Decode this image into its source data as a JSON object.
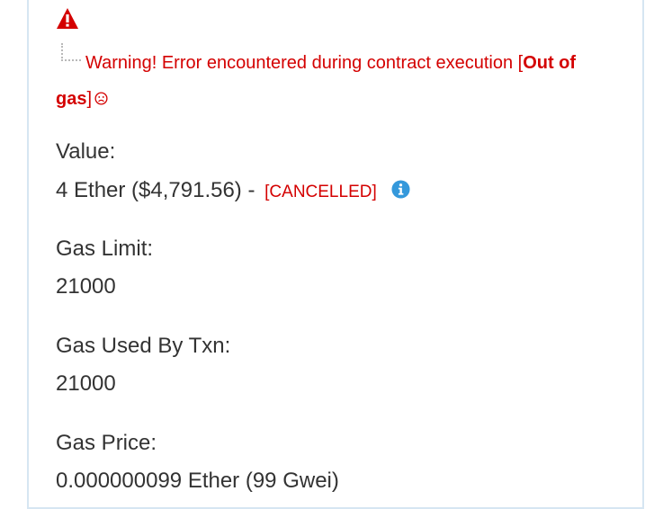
{
  "warning": {
    "icon": "warning-triangle-icon",
    "prefix": "Warning! Error encountered during contract execution [",
    "reason": "Out of gas",
    "suffix": "]",
    "face_icon": "sad-face-icon",
    "color": "#d40000"
  },
  "fields": {
    "value": {
      "label": "Value:",
      "amount": "4 Ether ($4,791.56) -",
      "status": "[CANCELLED]",
      "info_icon": "info-icon",
      "info_color": "#3498db"
    },
    "gas_limit": {
      "label": "Gas Limit:",
      "value": "21000"
    },
    "gas_used": {
      "label": "Gas Used By Txn:",
      "value": "21000"
    },
    "gas_price": {
      "label": "Gas Price:",
      "value": "0.000000099 Ether (99 Gwei)"
    }
  }
}
